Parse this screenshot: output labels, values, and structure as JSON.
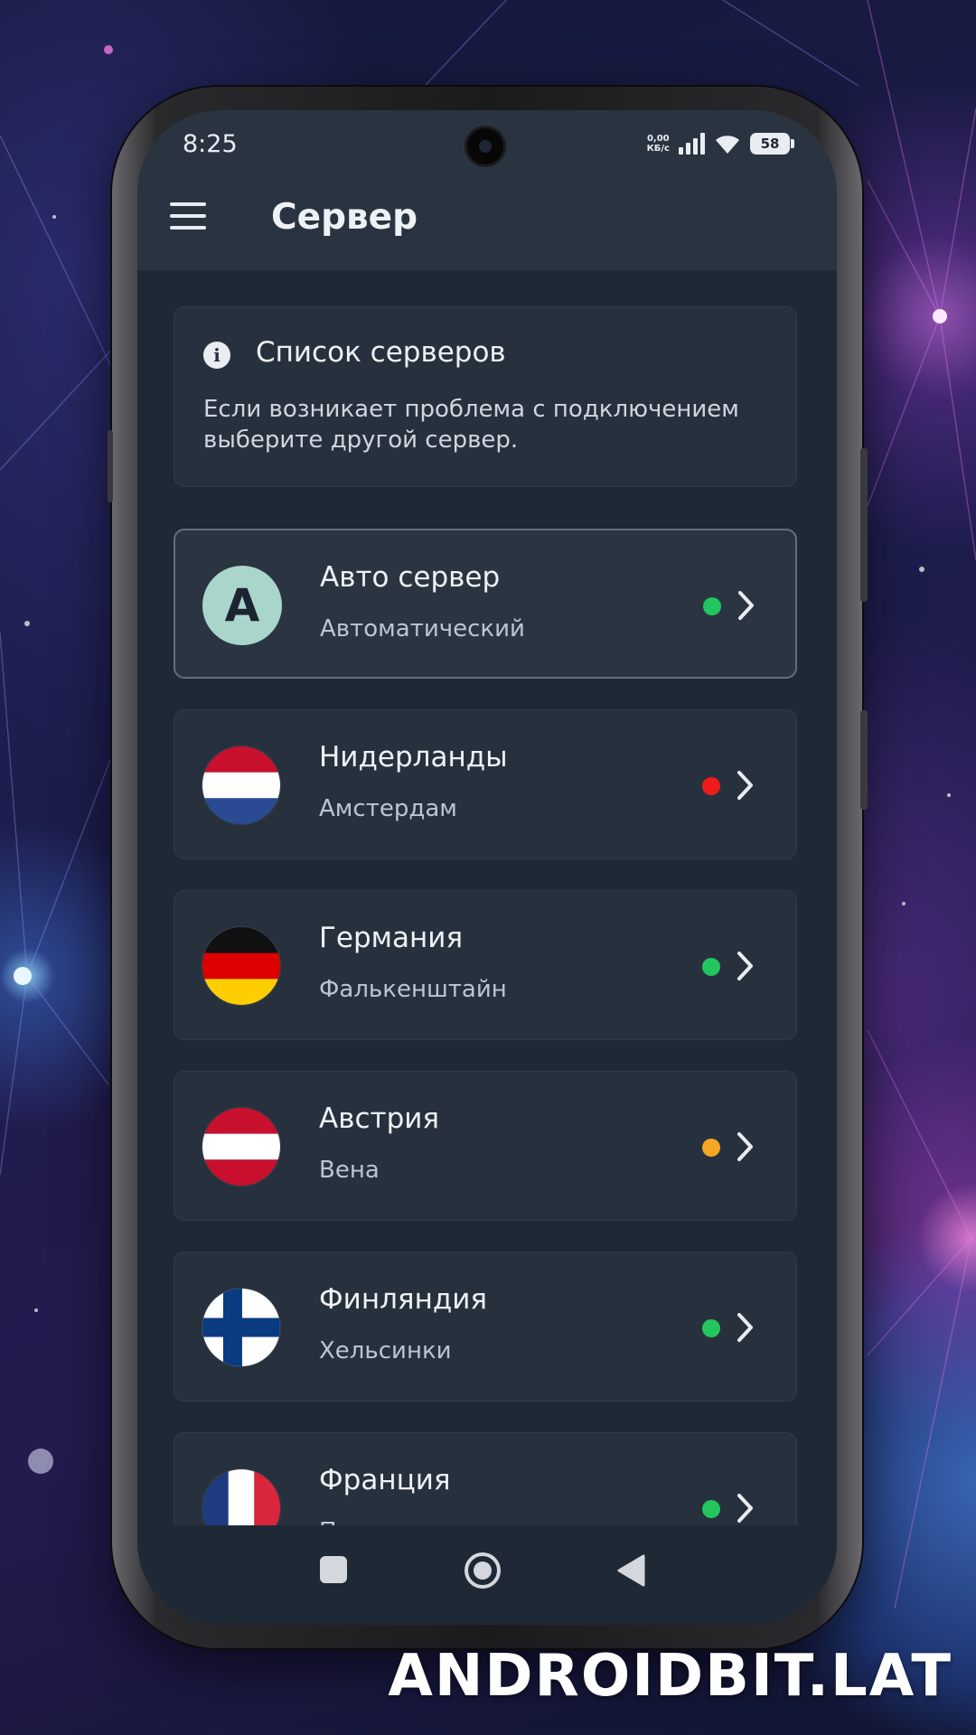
{
  "status_bar": {
    "time": "8:25",
    "net_speed_value": "0,00",
    "net_speed_unit": "КБ/с",
    "battery": "58"
  },
  "app_bar": {
    "title": "Сервер",
    "menu_icon": "menu-icon"
  },
  "info_card": {
    "icon": "info-icon",
    "title": "Список серверов",
    "text": "Если возникает проблема с подключением выберите другой сервер."
  },
  "servers": [
    {
      "name": "Авто сервер",
      "city": "Автоматический",
      "badge": "A",
      "flag": "auto",
      "status_color": "#22c55e",
      "selected": true
    },
    {
      "name": "Нидерланды",
      "city": "Амстердам",
      "flag": "netherlands",
      "status_color": "#ef1b1b",
      "selected": false
    },
    {
      "name": "Германия",
      "city": "Фалькенштайн",
      "flag": "germany",
      "status_color": "#22c55e",
      "selected": false
    },
    {
      "name": "Австрия",
      "city": "Вена",
      "flag": "austria",
      "status_color": "#f5a623",
      "selected": false
    },
    {
      "name": "Финляндия",
      "city": "Хельсинки",
      "flag": "finland",
      "status_color": "#22c55e",
      "selected": false
    },
    {
      "name": "Франция",
      "city": "Париж",
      "flag": "france",
      "status_color": "#22c55e",
      "selected": false
    }
  ],
  "nav_bar": {
    "recents_icon": "square-icon",
    "home_icon": "circle-home-icon",
    "back_icon": "triangle-back-icon"
  },
  "watermark": "ANDROIDBIT.LAT",
  "colors": {
    "app_bar": "#2a3441",
    "screen_bg": "#1f2935",
    "card_bg": "#27313d",
    "accent_auto": "#a9d5cb"
  }
}
